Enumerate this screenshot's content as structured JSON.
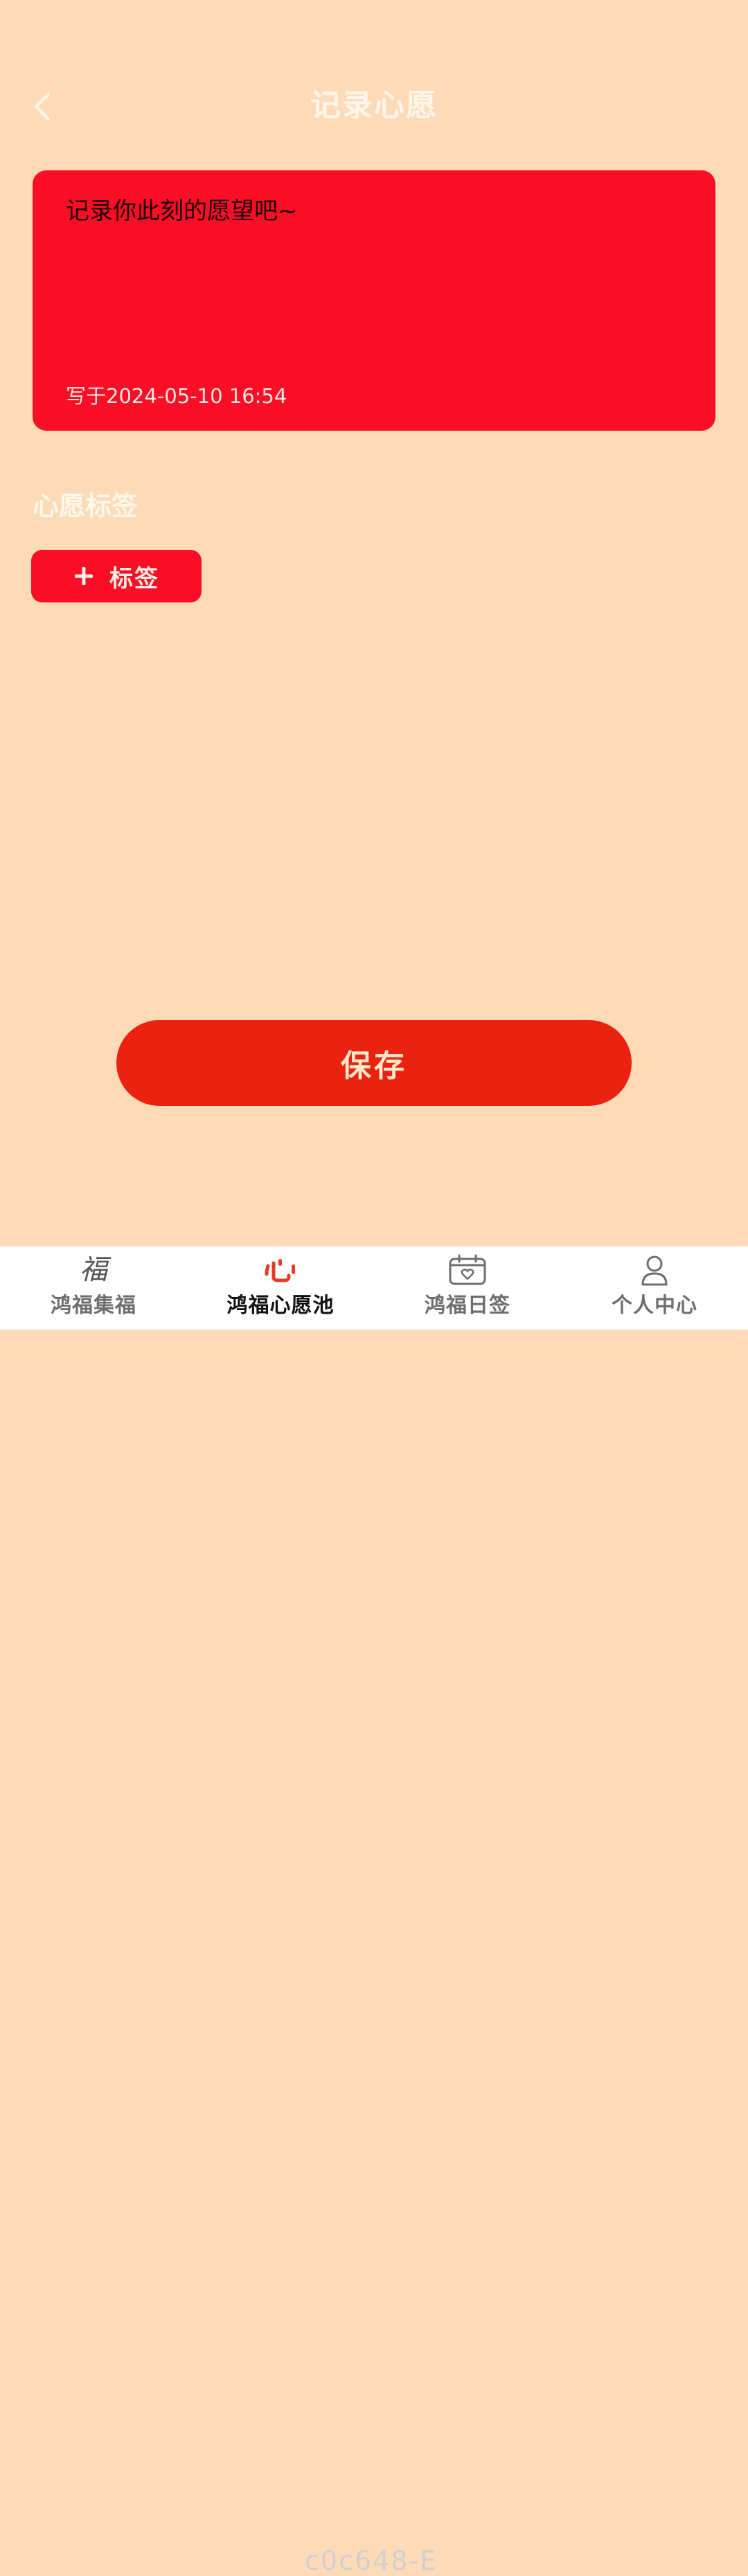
{
  "header": {
    "title": "记录心愿",
    "back_icon": "chevron-left-icon"
  },
  "wish_card": {
    "placeholder": "记录你此刻的愿望吧~",
    "written_at": "写于2024-05-10 16:54"
  },
  "tags": {
    "section_title": "心愿标签",
    "add_label": "标签",
    "add_icon": "plus-icon"
  },
  "save": {
    "label": "保存"
  },
  "bottom_nav": {
    "items": [
      {
        "label": "鸿福集福",
        "icon": "fu-icon",
        "glyph": "福",
        "active": false
      },
      {
        "label": "鸿福心愿池",
        "icon": "heart-wish-icon",
        "active": true
      },
      {
        "label": "鸿福日签",
        "icon": "calendar-heart-icon",
        "active": false
      },
      {
        "label": "个人中心",
        "icon": "person-icon",
        "active": false
      }
    ],
    "watermark": "c0c648-E"
  },
  "colors": {
    "background": "#FDDBB7",
    "card_red": "#FB0E26",
    "save_red": "#EC2211",
    "active_icon": "#E63A22"
  }
}
